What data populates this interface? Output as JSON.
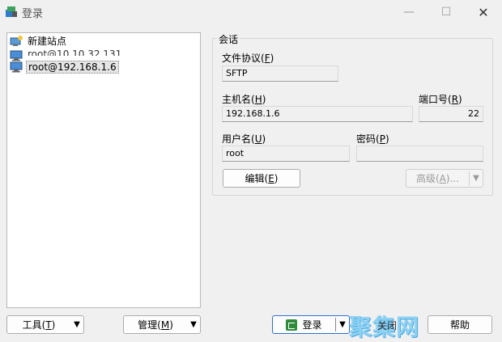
{
  "window": {
    "title": "登录"
  },
  "tree": {
    "items": [
      {
        "label": "新建站点"
      },
      {
        "label": "root@10.10.32.131"
      },
      {
        "label": "root@192.168.1.6"
      }
    ]
  },
  "session": {
    "group_title": "会话",
    "protocol": {
      "label": "文件协议",
      "key": "F",
      "value": "SFTP"
    },
    "host": {
      "label": "主机名",
      "key": "H",
      "value": "192.168.1.6"
    },
    "port": {
      "label": "端口号",
      "key": "R",
      "value": "22"
    },
    "user": {
      "label": "用户名",
      "key": "U",
      "value": "root"
    },
    "password": {
      "label": "密码",
      "key": "P",
      "value": ""
    },
    "edit_button": {
      "label": "编辑",
      "key": "E"
    },
    "advanced_button": {
      "label": "高级",
      "key": "A",
      "suffix": "..."
    }
  },
  "footer": {
    "tools": {
      "label": "工具",
      "key": "T"
    },
    "manage": {
      "label": "管理",
      "key": "M"
    },
    "login": "登录",
    "close": "关闭",
    "help": "帮助"
  },
  "watermark": "聚集网"
}
